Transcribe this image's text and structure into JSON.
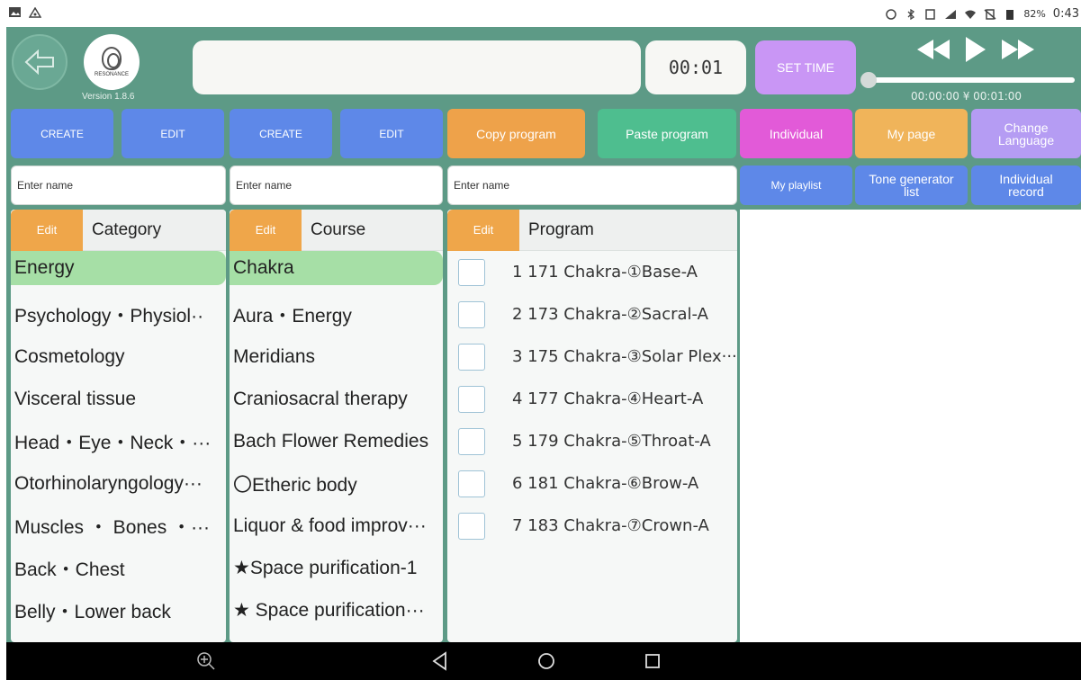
{
  "status_bar": {
    "battery": "82%",
    "time": "0:43"
  },
  "header": {
    "logo_text": "RESONANCE",
    "version": "Version 1.8.6",
    "title_value": "",
    "timer": "00:01",
    "set_time_label": "SET TIME",
    "time_range": "00:00:00 ¥ 00:01:00",
    "progress_fraction": 0.0
  },
  "buttons": {
    "create1": "CREATE",
    "edit1": "EDIT",
    "create2": "CREATE",
    "edit2": "EDIT",
    "copy_program": "Copy program",
    "paste_program": "Paste program",
    "individual": "Individual",
    "my_page": "My page",
    "change_language_1": "Change",
    "change_language_2": "Language",
    "my_playlist": "My playlist",
    "tone_generator_1": "Tone generator",
    "tone_generator_2": "list",
    "individual_record_1": "Individual",
    "individual_record_2": "record"
  },
  "inputs": {
    "category_placeholder": "Enter name",
    "course_placeholder": "Enter name",
    "program_placeholder": "Enter name"
  },
  "category": {
    "edit": "Edit",
    "title": "Category",
    "items": [
      "Energy",
      "Psychology・Physiol··",
      "Cosmetology",
      "Visceral tissue",
      "Head・Eye・Neck・···",
      "Otorhinolaryngology···",
      "Muscles ・ Bones ・···",
      "Back・Chest",
      "Belly・Lower back"
    ]
  },
  "course": {
    "edit": "Edit",
    "title": "Course",
    "items": [
      "Chakra",
      "Aura・Energy",
      "Meridians",
      "Craniosacral therapy",
      "Bach Flower Remedies",
      "〇Etheric body",
      "Liquor & food improv···",
      "★Space purification-1",
      "★ Space purification···"
    ]
  },
  "program": {
    "edit": "Edit",
    "title": "Program",
    "items": [
      "1 171 Chakra-①Base-A",
      "2 173 Chakra-②Sacral-A",
      "3 175 Chakra-③Solar Plex···",
      "4 177 Chakra-④Heart-A",
      "5 179 Chakra-⑤Throat-A",
      "6 181 Chakra-⑥Brow-A",
      "7 183 Chakra-⑦Crown-A"
    ]
  },
  "colors": {
    "app_bg": "#5d9a86",
    "blue_button": "#5e88e8",
    "orange_button": "#eea24a",
    "green_button": "#4ebe8f",
    "pink_button": "#e25ad8",
    "purple_button": "#b59cf3",
    "selected_row": "#a6dfa6"
  }
}
